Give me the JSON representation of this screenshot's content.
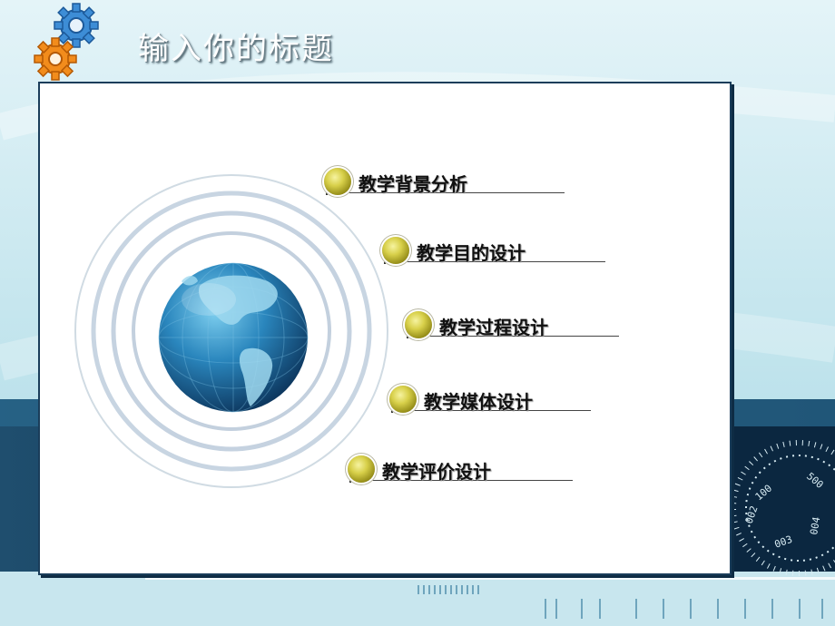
{
  "slide": {
    "title": "输入你的标题",
    "items": [
      {
        "label": "教学背景分析"
      },
      {
        "label": "教学目的设计"
      },
      {
        "label": "教学过程设计"
      },
      {
        "label": "教学媒体设计"
      },
      {
        "label": "教学评价设计"
      }
    ],
    "dial_numbers": [
      "100",
      "500",
      "002",
      "003",
      "004"
    ]
  },
  "colors": {
    "accent_yellow": "#d8d04a",
    "dark_navy": "#1a3d5a",
    "sky": "#d6eef3",
    "globe_blue": "#1c6b9c"
  },
  "icons": [
    "gear-blue-icon",
    "gear-orange-icon",
    "globe-icon",
    "bullet-ball-icon"
  ]
}
